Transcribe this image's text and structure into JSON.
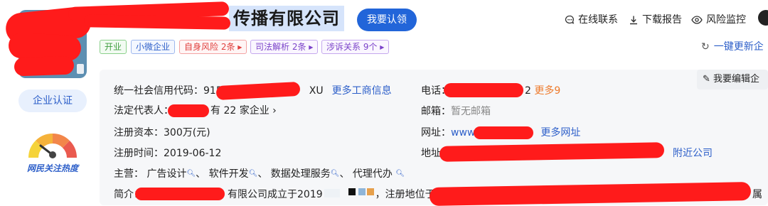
{
  "header": {
    "company_name_visible": "传播有限公司",
    "claim_button": "我要认领"
  },
  "top_actions": {
    "online_contact": "在线联系",
    "download_report": "下载报告",
    "risk_monitor": "风险监控"
  },
  "tags": {
    "open": "开业",
    "small_micro": "小微企业",
    "self_risk": "自身风险 2条",
    "judicial": "司法解析 2条",
    "litigation": "涉诉关系 9个"
  },
  "update_link": "一键更新企",
  "left_panel": {
    "cert_button": "企业认证",
    "heat_label": "网民关注热度"
  },
  "edit_button": "我要编辑企",
  "info": {
    "credit_code_label": "统一社会信用代码：",
    "credit_code_prefix": "915",
    "credit_code_suffix": "XU",
    "more_business_info": "更多工商信息",
    "legal_rep_label": "法定代表人：",
    "legal_rep_companies": "有 22 家企业",
    "registered_capital_label": "注册资本：",
    "registered_capital": "300万(元)",
    "registration_date_label": "注册时间：",
    "registration_date": "2019-06-12",
    "main_business_label": "主营：",
    "main_business": [
      "广告设计",
      "软件开发",
      "数据处理服务",
      "代理代办"
    ],
    "intro_label": "简介：",
    "intro_mid": "有限公司成立于2019",
    "intro_mid2": "，注册地位于中",
    "intro_end": "属",
    "phone_label": "电话：",
    "phone_digit": "2",
    "phone_more": "更多9",
    "email_label": "邮箱：",
    "email_value": "暂无邮箱",
    "website_label": "网址：",
    "website_prefix": "www",
    "website_more": "更多网址",
    "address_label": "地址：",
    "nearby_companies": "附近公司"
  },
  "colors": {
    "accent_blue": "#2265d9",
    "redaction_red": "#ff1b1b",
    "orange": "#ee7a2b"
  }
}
